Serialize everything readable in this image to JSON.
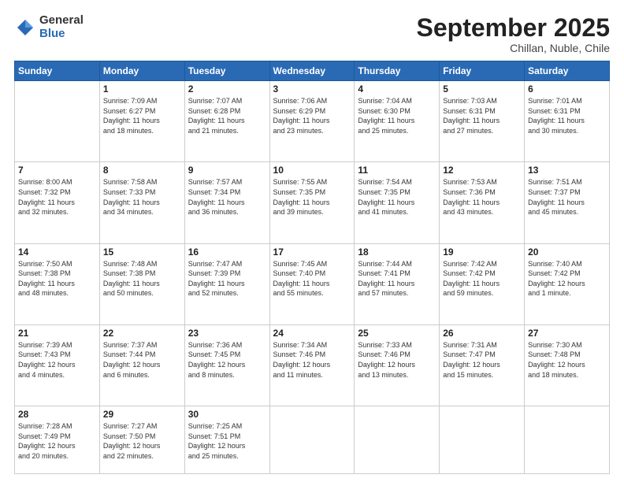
{
  "logo": {
    "general": "General",
    "blue": "Blue"
  },
  "header": {
    "month": "September 2025",
    "location": "Chillan, Nuble, Chile"
  },
  "weekdays": [
    "Sunday",
    "Monday",
    "Tuesday",
    "Wednesday",
    "Thursday",
    "Friday",
    "Saturday"
  ],
  "weeks": [
    [
      {
        "day": "",
        "info": ""
      },
      {
        "day": "1",
        "info": "Sunrise: 7:09 AM\nSunset: 6:27 PM\nDaylight: 11 hours\nand 18 minutes."
      },
      {
        "day": "2",
        "info": "Sunrise: 7:07 AM\nSunset: 6:28 PM\nDaylight: 11 hours\nand 21 minutes."
      },
      {
        "day": "3",
        "info": "Sunrise: 7:06 AM\nSunset: 6:29 PM\nDaylight: 11 hours\nand 23 minutes."
      },
      {
        "day": "4",
        "info": "Sunrise: 7:04 AM\nSunset: 6:30 PM\nDaylight: 11 hours\nand 25 minutes."
      },
      {
        "day": "5",
        "info": "Sunrise: 7:03 AM\nSunset: 6:31 PM\nDaylight: 11 hours\nand 27 minutes."
      },
      {
        "day": "6",
        "info": "Sunrise: 7:01 AM\nSunset: 6:31 PM\nDaylight: 11 hours\nand 30 minutes."
      }
    ],
    [
      {
        "day": "7",
        "info": "Sunrise: 8:00 AM\nSunset: 7:32 PM\nDaylight: 11 hours\nand 32 minutes."
      },
      {
        "day": "8",
        "info": "Sunrise: 7:58 AM\nSunset: 7:33 PM\nDaylight: 11 hours\nand 34 minutes."
      },
      {
        "day": "9",
        "info": "Sunrise: 7:57 AM\nSunset: 7:34 PM\nDaylight: 11 hours\nand 36 minutes."
      },
      {
        "day": "10",
        "info": "Sunrise: 7:55 AM\nSunset: 7:35 PM\nDaylight: 11 hours\nand 39 minutes."
      },
      {
        "day": "11",
        "info": "Sunrise: 7:54 AM\nSunset: 7:35 PM\nDaylight: 11 hours\nand 41 minutes."
      },
      {
        "day": "12",
        "info": "Sunrise: 7:53 AM\nSunset: 7:36 PM\nDaylight: 11 hours\nand 43 minutes."
      },
      {
        "day": "13",
        "info": "Sunrise: 7:51 AM\nSunset: 7:37 PM\nDaylight: 11 hours\nand 45 minutes."
      }
    ],
    [
      {
        "day": "14",
        "info": "Sunrise: 7:50 AM\nSunset: 7:38 PM\nDaylight: 11 hours\nand 48 minutes."
      },
      {
        "day": "15",
        "info": "Sunrise: 7:48 AM\nSunset: 7:38 PM\nDaylight: 11 hours\nand 50 minutes."
      },
      {
        "day": "16",
        "info": "Sunrise: 7:47 AM\nSunset: 7:39 PM\nDaylight: 11 hours\nand 52 minutes."
      },
      {
        "day": "17",
        "info": "Sunrise: 7:45 AM\nSunset: 7:40 PM\nDaylight: 11 hours\nand 55 minutes."
      },
      {
        "day": "18",
        "info": "Sunrise: 7:44 AM\nSunset: 7:41 PM\nDaylight: 11 hours\nand 57 minutes."
      },
      {
        "day": "19",
        "info": "Sunrise: 7:42 AM\nSunset: 7:42 PM\nDaylight: 11 hours\nand 59 minutes."
      },
      {
        "day": "20",
        "info": "Sunrise: 7:40 AM\nSunset: 7:42 PM\nDaylight: 12 hours\nand 1 minute."
      }
    ],
    [
      {
        "day": "21",
        "info": "Sunrise: 7:39 AM\nSunset: 7:43 PM\nDaylight: 12 hours\nand 4 minutes."
      },
      {
        "day": "22",
        "info": "Sunrise: 7:37 AM\nSunset: 7:44 PM\nDaylight: 12 hours\nand 6 minutes."
      },
      {
        "day": "23",
        "info": "Sunrise: 7:36 AM\nSunset: 7:45 PM\nDaylight: 12 hours\nand 8 minutes."
      },
      {
        "day": "24",
        "info": "Sunrise: 7:34 AM\nSunset: 7:46 PM\nDaylight: 12 hours\nand 11 minutes."
      },
      {
        "day": "25",
        "info": "Sunrise: 7:33 AM\nSunset: 7:46 PM\nDaylight: 12 hours\nand 13 minutes."
      },
      {
        "day": "26",
        "info": "Sunrise: 7:31 AM\nSunset: 7:47 PM\nDaylight: 12 hours\nand 15 minutes."
      },
      {
        "day": "27",
        "info": "Sunrise: 7:30 AM\nSunset: 7:48 PM\nDaylight: 12 hours\nand 18 minutes."
      }
    ],
    [
      {
        "day": "28",
        "info": "Sunrise: 7:28 AM\nSunset: 7:49 PM\nDaylight: 12 hours\nand 20 minutes."
      },
      {
        "day": "29",
        "info": "Sunrise: 7:27 AM\nSunset: 7:50 PM\nDaylight: 12 hours\nand 22 minutes."
      },
      {
        "day": "30",
        "info": "Sunrise: 7:25 AM\nSunset: 7:51 PM\nDaylight: 12 hours\nand 25 minutes."
      },
      {
        "day": "",
        "info": ""
      },
      {
        "day": "",
        "info": ""
      },
      {
        "day": "",
        "info": ""
      },
      {
        "day": "",
        "info": ""
      }
    ]
  ]
}
